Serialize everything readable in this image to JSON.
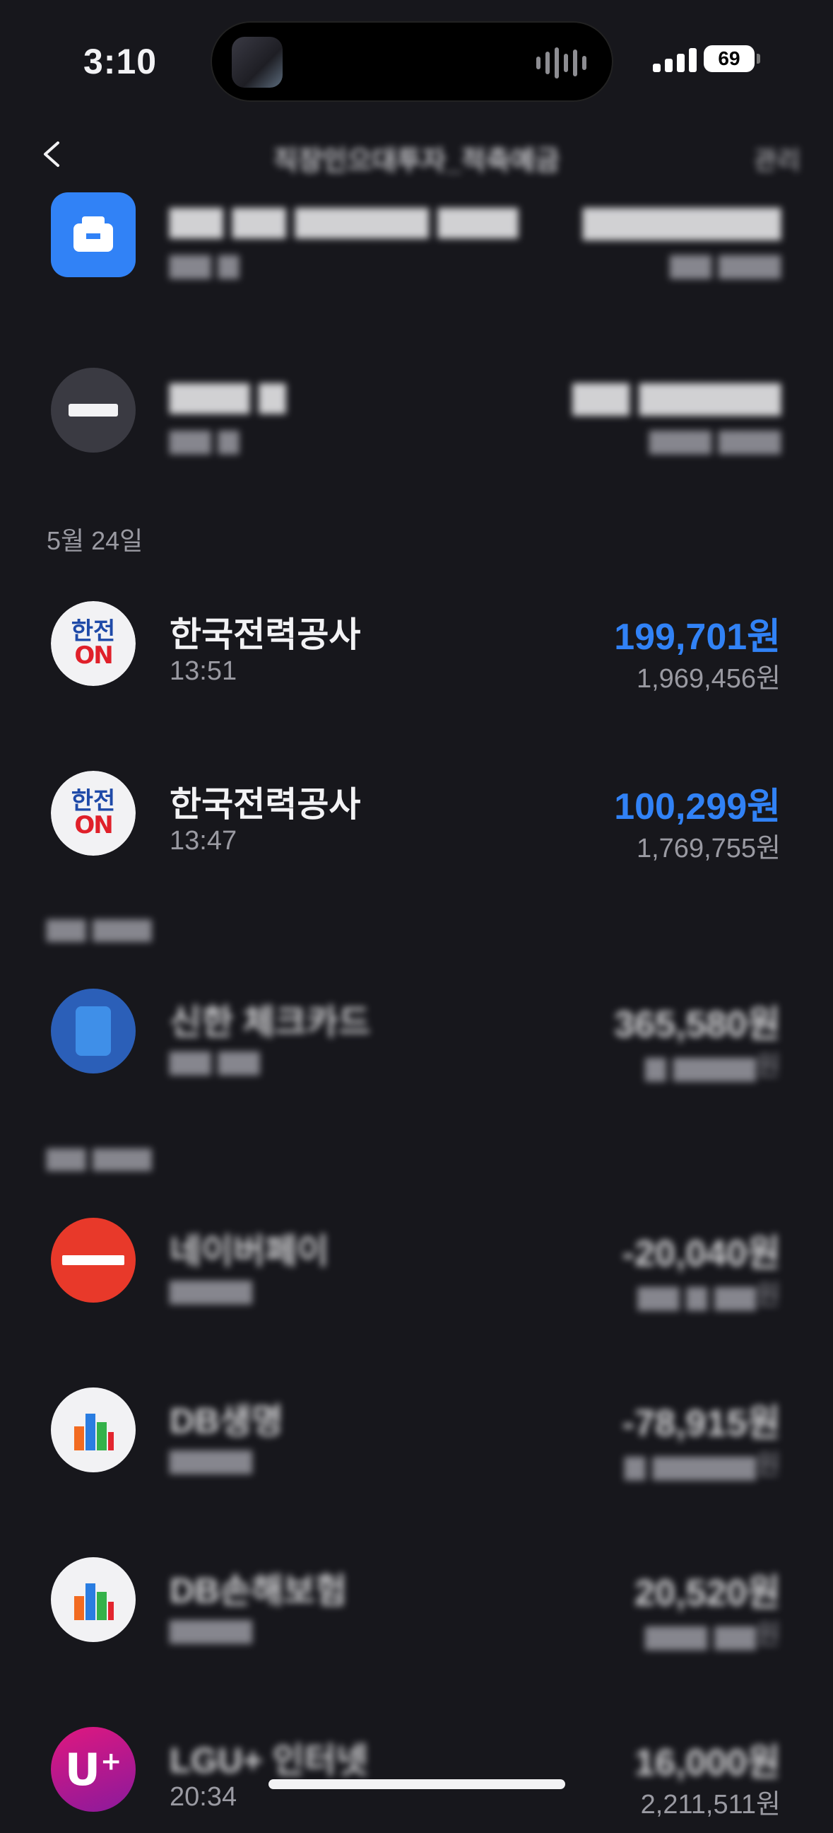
{
  "status_bar": {
    "time": "3:10",
    "battery": "69"
  },
  "header": {
    "title": "직장인으대투자_적축예금",
    "manage": "관리"
  },
  "transactions": [
    {
      "date": "",
      "name": "",
      "sub": "",
      "amount": "",
      "balance": "",
      "icon": "wallet-icon",
      "color": "#3182f6",
      "blurred": true
    },
    {
      "date": "",
      "name": "",
      "sub": "",
      "amount": "",
      "balance": "",
      "icon": "dark-card-icon",
      "color": "#3a3a42",
      "blurred": true
    },
    {
      "date": "5월 24일",
      "name": "한국전력공사",
      "sub": "13:51",
      "amount": "199,701원",
      "balance": "1,969,456원",
      "icon": "kepco-logo",
      "blue": true
    },
    {
      "date": "",
      "name": "한국전력공사",
      "sub": "13:47",
      "amount": "100,299원",
      "balance": "1,769,755원",
      "icon": "kepco-logo",
      "blue": true
    },
    {
      "date": "",
      "name": "신한 체크카드",
      "sub": "",
      "amount": "365,580원",
      "balance": "",
      "icon": "card-icon",
      "color": "#2b5fb8",
      "blurred": true
    },
    {
      "date": "",
      "name": "네이버페이",
      "sub": "",
      "amount": "-20,040원",
      "balance": "",
      "icon": "red-logo-icon",
      "color": "#e8392a",
      "blurred": true
    },
    {
      "date": "",
      "name": "DB생명",
      "sub": "",
      "amount": "-78,915원",
      "balance": "",
      "icon": "db-logo-icon",
      "color": "#f2f2f4",
      "blurred": true
    },
    {
      "date": "",
      "name": "DB손해보험",
      "sub": "",
      "amount": "20,520원",
      "balance": "",
      "icon": "db-logo-icon",
      "color": "#f2f2f4",
      "blurred": true
    },
    {
      "date": "",
      "name": "LGU+ 인터넷",
      "sub": "20:34",
      "amount": "16,000원",
      "balance": "2,211,511원",
      "icon": "uplus-logo-icon",
      "color": "#c0147a",
      "blurred": true
    }
  ]
}
